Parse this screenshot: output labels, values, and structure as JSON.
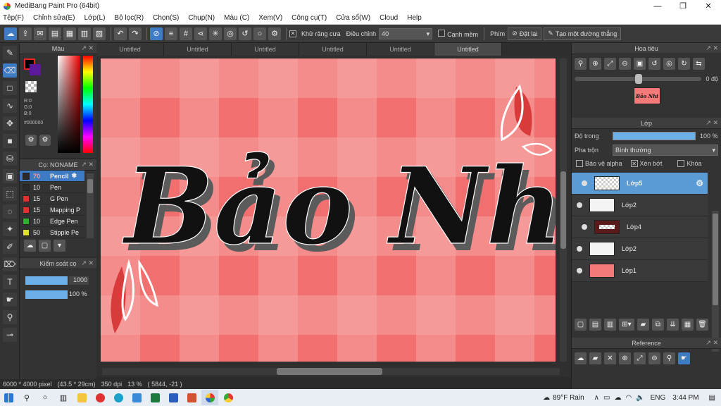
{
  "window": {
    "title": "MediBang Paint Pro (64bit)",
    "minimize": "—",
    "maximize": "❐",
    "close": "✕"
  },
  "menu": [
    "Tệp(F)",
    "Chỉnh sửa(E)",
    "Lớp(L)",
    "Bộ lọc(R)",
    "Chọn(S)",
    "Chụp(N)",
    "Màu (C)",
    "Xem(V)",
    "Công cụ(T)",
    "Cửa sổ(W)",
    "Cloud",
    "Help"
  ],
  "toolbar": {
    "antialias_label": "Khử răng cưa",
    "adjust_label": "Điều chỉnh",
    "adjust_value": "40",
    "soft_edge_label": "Cạnh mềm",
    "key_label": "Phím",
    "reset_label": "Đặt lại",
    "straight_line_label": "Tạo một đường thẳng"
  },
  "color_panel": {
    "title": "Màu",
    "r": "R:0",
    "g": "G:0",
    "b": "B:0",
    "hex": "#000000",
    "fg": "#000000",
    "bg": "#5a1a9a"
  },
  "brush_panel": {
    "title": "Cọ: NONAME",
    "brushes": [
      {
        "size": "70",
        "name": "Pencil",
        "color": "#2a2a2a"
      },
      {
        "size": "10",
        "name": "Pen",
        "color": "#2a2a2a"
      },
      {
        "size": "15",
        "name": "G Pen",
        "color": "#e03030"
      },
      {
        "size": "15",
        "name": "Mapping P",
        "color": "#e03030"
      },
      {
        "size": "10",
        "name": "Edge Pen",
        "color": "#30b030"
      },
      {
        "size": "50",
        "name": "Stipple Pe",
        "color": "#e0e030"
      }
    ]
  },
  "control_panel": {
    "title": "Kiểm soát cọ",
    "size_value": "1000",
    "opacity_value": "100 %",
    "size_fill": 1.0,
    "opacity_fill": 1.0
  },
  "tabs": [
    "Untitled",
    "Untitled",
    "Untitled",
    "Untitled",
    "Untitled",
    "Untitled"
  ],
  "canvas": {
    "text": "Bảo Nhi"
  },
  "status": {
    "size": "6000 * 4000 pixel",
    "cm": "(43.5 * 29cm)",
    "dpi": "350 dpi",
    "zoom": "13 %",
    "coords": "( 5844, -21 )"
  },
  "navigator": {
    "title": "Hoa tiêu",
    "angle": "0 độ",
    "thumb_text": "Bảo Nhi"
  },
  "layer_panel": {
    "title": "Lớp",
    "opacity_label": "Độ trong",
    "opacity_value": "100 %",
    "opacity_fill": 1.0,
    "blend_label": "Pha trộn",
    "blend_value": "Bình thường",
    "protect_alpha": "Bảo vệ alpha",
    "clipping": "Xén bớt",
    "lock": "Khóa",
    "layers": [
      {
        "name": "Lớp5",
        "thumb": "#dddddd",
        "selected": true
      },
      {
        "name": "Lớp2",
        "thumb": "#f4f4f4",
        "selected": false
      },
      {
        "name": "Lớp4",
        "thumb": "#5a1a1a",
        "selected": false
      },
      {
        "name": "Lớp2",
        "thumb": "#f4f4f4",
        "selected": false
      },
      {
        "name": "Lớp1",
        "thumb": "#f47a7a",
        "selected": false
      }
    ]
  },
  "reference": {
    "title": "Reference"
  },
  "taskbar": {
    "weather": "89°F Rain",
    "lang": "ENG",
    "time": "3:44 PM"
  }
}
